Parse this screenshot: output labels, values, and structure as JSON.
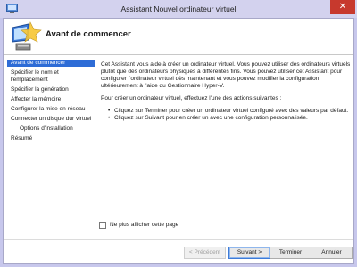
{
  "window": {
    "title": "Assistant Nouvel ordinateur virtuel",
    "close_symbol": "✕"
  },
  "header": {
    "title": "Avant de commencer",
    "icon": "computer-wizard-icon"
  },
  "nav": {
    "items": [
      {
        "label": "Avant de commencer",
        "active": true
      },
      {
        "label": "Spécifier le nom et l'emplacement"
      },
      {
        "label": "Spécifier la génération"
      },
      {
        "label": "Affecter la mémoire"
      },
      {
        "label": "Configurer la mise en réseau"
      },
      {
        "label": "Connecter un disque dur virtuel"
      },
      {
        "label": "Options d'installation",
        "sub": true
      },
      {
        "label": "Résumé"
      }
    ]
  },
  "content": {
    "intro": "Cet Assistant vous aide à créer un ordinateur virtuel. Vous pouvez utiliser des ordinateurs virtuels plutôt que des ordinateurs physiques à différentes fins. Vous pouvez utiliser cet Assistant pour configurer l'ordinateur virtuel dès maintenant et vous pouvez modifier la configuration ultérieurement à l'aide du Gestionnaire Hyper-V.",
    "actions_intro": "Pour créer un ordinateur virtuel, effectuez l'une des actions suivantes :",
    "bullet": "•",
    "actions": [
      "Cliquez sur Terminer pour créer un ordinateur virtuel configuré avec des valeurs par défaut.",
      "Cliquez sur Suivant pour en créer un avec une configuration personnalisée."
    ]
  },
  "footer": {
    "dont_show_label": "Ne plus afficher cette page",
    "dont_show_checked": false,
    "buttons": {
      "previous": "< Précédent",
      "next": "Suivant >",
      "finish": "Terminer",
      "cancel": "Annuler"
    }
  },
  "colors": {
    "nav_active": "#2e6cd6",
    "close_button": "#c7392d",
    "titlebar": "#d3d2ee"
  }
}
